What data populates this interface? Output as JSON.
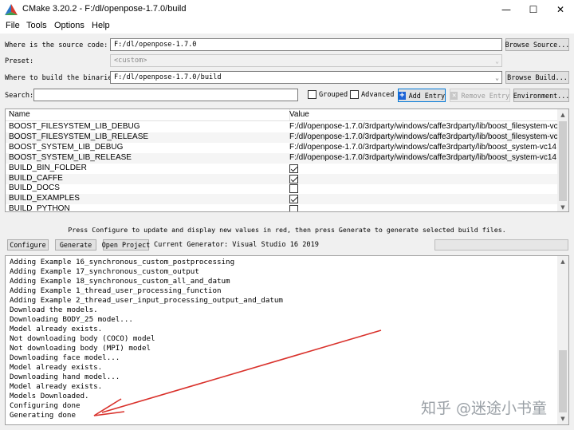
{
  "window": {
    "title": "CMake 3.20.2 - F:/dl/openpose-1.7.0/build",
    "minimize_glyph": "—",
    "maximize_glyph": "☐",
    "close_glyph": "✕"
  },
  "menu": {
    "items": [
      "File",
      "Tools",
      "Options",
      "Help"
    ]
  },
  "config": {
    "source_label": "Where is the source code:",
    "source_value": "F:/dl/openpose-1.7.0",
    "browse_source": "Browse Source...",
    "preset_label": "Preset:",
    "preset_value": "<custom>",
    "binaries_label": "Where to build the binaries:",
    "binaries_value": "F:/dl/openpose-1.7.0/build",
    "browse_build": "Browse Build..."
  },
  "search": {
    "label": "Search:",
    "value": "",
    "grouped_label": "Grouped",
    "grouped_checked": false,
    "advanced_label": "Advanced",
    "advanced_checked": false,
    "add_entry": "Add Entry",
    "remove_entry": "Remove Entry",
    "environment": "Environment..."
  },
  "table": {
    "col_name": "Name",
    "col_value": "Value",
    "rows": [
      {
        "name": "BOOST_FILESYSTEM_LIB_DEBUG",
        "value": "F:/dl/openpose-1.7.0/3rdparty/windows/caffe3rdparty/lib/boost_filesystem-vc"
      },
      {
        "name": "BOOST_FILESYSTEM_LIB_RELEASE",
        "value": "F:/dl/openpose-1.7.0/3rdparty/windows/caffe3rdparty/lib/boost_filesystem-vc"
      },
      {
        "name": "BOOST_SYSTEM_LIB_DEBUG",
        "value": "F:/dl/openpose-1.7.0/3rdparty/windows/caffe3rdparty/lib/boost_system-vc14"
      },
      {
        "name": "BOOST_SYSTEM_LIB_RELEASE",
        "value": "F:/dl/openpose-1.7.0/3rdparty/windows/caffe3rdparty/lib/boost_system-vc14"
      },
      {
        "name": "BUILD_BIN_FOLDER",
        "checked": true
      },
      {
        "name": "BUILD_CAFFE",
        "checked": true
      },
      {
        "name": "BUILD_DOCS",
        "checked": false
      },
      {
        "name": "BUILD_EXAMPLES",
        "checked": true
      },
      {
        "name": "BUILD_PYTHON",
        "checked": false
      }
    ]
  },
  "status_message": "Press Configure to update and display new values in red, then press Generate to generate selected build files.",
  "actions": {
    "configure": "Configure",
    "generate": "Generate",
    "open_project": "Open Project",
    "generator_text": "Current Generator: Visual Studio 16 2019"
  },
  "output": {
    "lines": [
      "Adding Example 16_synchronous_custom_postprocessing",
      "Adding Example 17_synchronous_custom_output",
      "Adding Example 18_synchronous_custom_all_and_datum",
      "Adding Example 1_thread_user_processing_function",
      "Adding Example 2_thread_user_input_processing_output_and_datum",
      "Download the models.",
      "Downloading BODY_25 model...",
      "Model already exists.",
      "Not downloading body (COCO) model",
      "Not downloading body (MPI) model",
      "Downloading face model...",
      "Model already exists.",
      "Downloading hand model...",
      "Model already exists.",
      "Models Downloaded.",
      "Configuring done",
      "Generating done"
    ]
  },
  "watermark": "知乎 @迷途小书童",
  "colors": {
    "arrow": "#d9312b",
    "window_bg": "#f0f0f0",
    "add_icon": "#1e63d6"
  }
}
